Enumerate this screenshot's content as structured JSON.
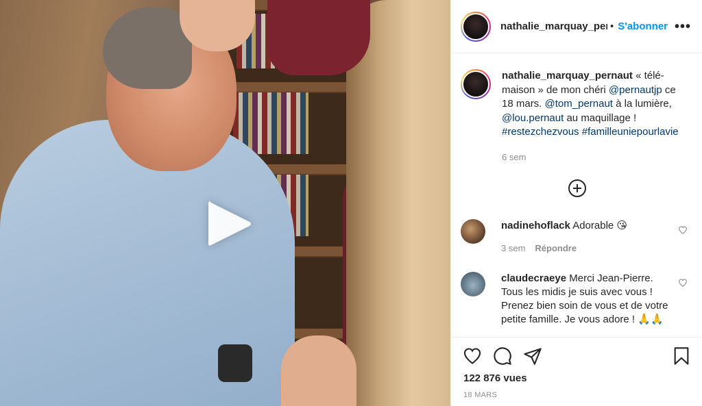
{
  "post": {
    "username": "nathalie_marquay_pernaut",
    "header_username_display": "nathalie_marquay_perr",
    "dot": "•",
    "follow_label": "S'abonner",
    "more_label": "•••",
    "caption": {
      "username": "nathalie_marquay_pernaut",
      "text_1": " « télé-maison » de mon chéri ",
      "mention_1": "@pernautjp",
      "text_2": " ce 18 mars. ",
      "mention_2": "@tom_pernaut",
      "text_3": " à la lumière, ",
      "mention_3": "@lou.pernaut",
      "text_4": " au maquillage ! ",
      "hashtag_1": "#restezchezvous",
      "hashtag_2": " #familleuniepourlavie",
      "time": "6 sem"
    }
  },
  "comments": [
    {
      "username": "nadinehoflack",
      "text": " Adorable 😘",
      "time": "3 sem",
      "reply_label": "Répondre"
    },
    {
      "username": "claudecraeye",
      "text": " Merci Jean-Pierre. Tous les midis je suis avec vous ! Prenez bien soin de vous et de votre petite famille. Je vous adore ! 🙏🙏"
    }
  ],
  "footer": {
    "views": "122 876 vues",
    "date": "18 MARS"
  },
  "icons": {
    "play": "play-icon",
    "load_more": "plus-circle-icon",
    "like": "heart-icon",
    "comment": "comment-icon",
    "share": "paper-plane-icon",
    "save": "bookmark-icon"
  },
  "colors": {
    "link_blue": "#0095f6",
    "mention": "#00376b",
    "muted": "#8e8e8e",
    "text": "#262626"
  }
}
